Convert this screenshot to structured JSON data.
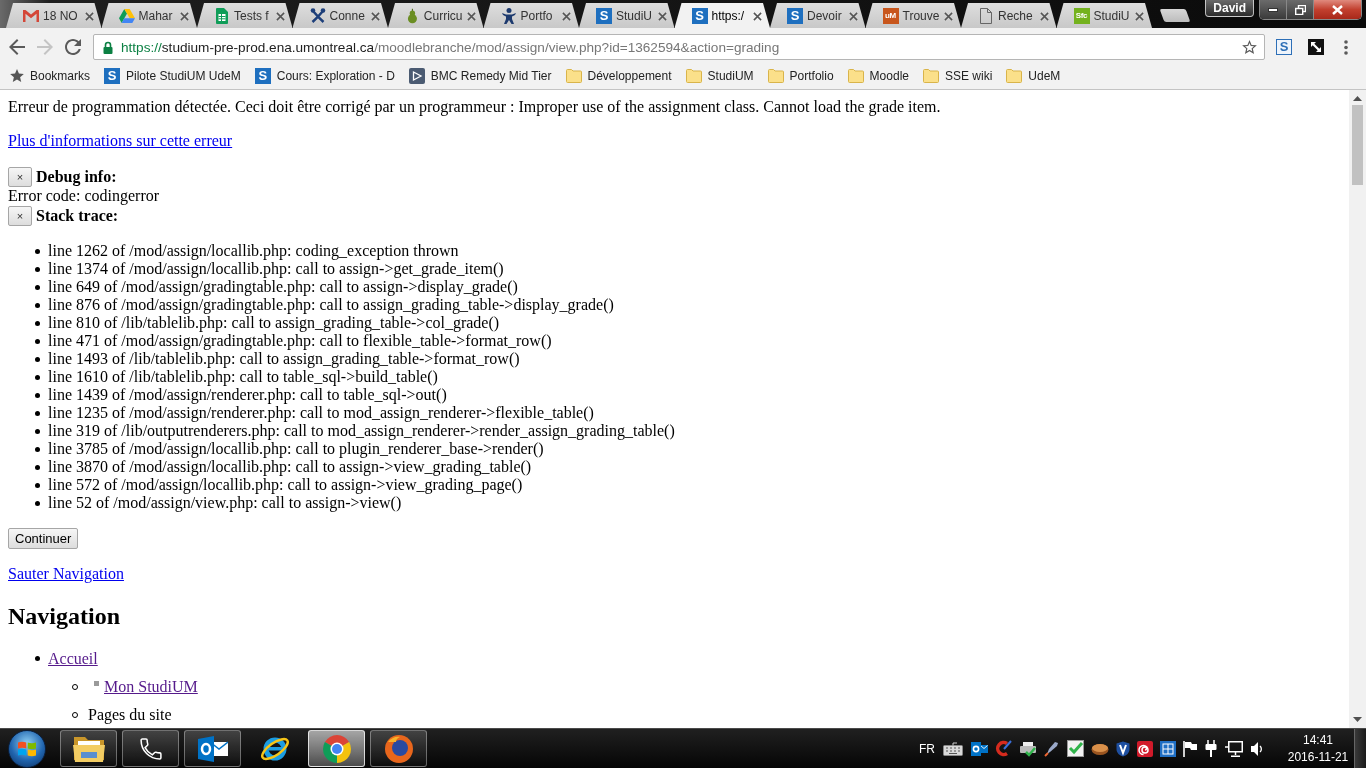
{
  "window": {
    "user": "David"
  },
  "tabs": [
    {
      "title": "18 NO",
      "kind": "mail",
      "selected": false
    },
    {
      "title": "Mahar",
      "kind": "drive",
      "selected": false
    },
    {
      "title": "Tests f",
      "kind": "sheet",
      "selected": false
    },
    {
      "title": "Conne",
      "kind": "tools",
      "selected": false
    },
    {
      "title": "Curricu",
      "kind": "gourd",
      "selected": false
    },
    {
      "title": "Portfo",
      "kind": "people",
      "selected": false
    },
    {
      "title": "StudiU",
      "kind": "letter",
      "logo_text": "S",
      "color": "#1e6fbf",
      "selected": false
    },
    {
      "title": "https:/",
      "kind": "letter",
      "logo_text": "S",
      "color": "#1e6fbf",
      "selected": true
    },
    {
      "title": "Devoir",
      "kind": "letter",
      "logo_text": "S",
      "color": "#1e6fbf",
      "selected": false
    },
    {
      "title": "Trouve",
      "kind": "letter",
      "logo_text": "uM",
      "color": "#c8561c",
      "selected": false
    },
    {
      "title": "Reche",
      "kind": "page",
      "selected": false
    },
    {
      "title": "StudiU",
      "kind": "letter",
      "logo_text": "Sfc",
      "color": "#74b21e",
      "selected": false
    }
  ],
  "toolbar": {
    "back_disabled": false,
    "forward_disabled": true,
    "address": {
      "scheme": "https://",
      "host": "studium-pre-prod.ena.umontreal.ca",
      "path": "/moodlebranche/mod/assign/view.php?id=1362594&action=grading"
    },
    "bookmarked": false,
    "extension_logo_text": "S"
  },
  "bookmarks": [
    {
      "label": "Bookmarks",
      "kind": "star"
    },
    {
      "label": "Pilote StudiUM UdeM",
      "kind": "letter",
      "logo_text": "S"
    },
    {
      "label": "Cours: Exploration - D",
      "kind": "letter",
      "logo_text": "S"
    },
    {
      "label": "BMC Remedy Mid Tier",
      "kind": "app"
    },
    {
      "label": "Développement",
      "kind": "folder"
    },
    {
      "label": "StudiUM",
      "kind": "folder"
    },
    {
      "label": "Portfolio",
      "kind": "folder"
    },
    {
      "label": "Moodle",
      "kind": "folder"
    },
    {
      "label": "SSE wiki",
      "kind": "folder"
    },
    {
      "label": "UdeM",
      "kind": "folder"
    }
  ],
  "page": {
    "error_message": "Erreur de programmation détectée. Ceci doit être corrigé par un programmeur : Improper use of the assignment class. Cannot load the grade item.",
    "more_info_link": {
      "label": "Plus d'informations sur cette erreur",
      "visited": false
    },
    "debug": {
      "toggle": "×",
      "title": "Debug info:",
      "text": "Error code: codingerror"
    },
    "stack": {
      "toggle": "×",
      "title": "Stack trace:",
      "lines": [
        "line 1262 of /mod/assign/locallib.php: coding_exception thrown",
        "line 1374 of /mod/assign/locallib.php: call to assign->get_grade_item()",
        "line 649 of /mod/assign/gradingtable.php: call to assign->display_grade()",
        "line 876 of /mod/assign/gradingtable.php: call to assign_grading_table->display_grade()",
        "line 810 of /lib/tablelib.php: call to assign_grading_table->col_grade()",
        "line 471 of /mod/assign/gradingtable.php: call to flexible_table->format_row()",
        "line 1493 of /lib/tablelib.php: call to assign_grading_table->format_row()",
        "line 1610 of /lib/tablelib.php: call to table_sql->build_table()",
        "line 1439 of /mod/assign/renderer.php: call to table_sql->out()",
        "line 1235 of /mod/assign/renderer.php: call to mod_assign_renderer->flexible_table()",
        "line 319 of /lib/outputrenderers.php: call to mod_assign_renderer->render_assign_grading_table()",
        "line 3785 of /mod/assign/locallib.php: call to plugin_renderer_base->render()",
        "line 3870 of /mod/assign/locallib.php: call to assign->view_grading_table()",
        "line 572 of /mod/assign/locallib.php: call to assign->view_grading_page()",
        "line 52 of /mod/assign/view.php: call to assign->view()"
      ]
    },
    "continue_button": "Continuer",
    "skip_link": {
      "label": "Sauter Navigation",
      "visited": false
    },
    "nav_heading": "Navigation",
    "nav": [
      {
        "label": "Accueil",
        "kind": "link",
        "visited": true,
        "children": [
          {
            "label": "Mon StudiUM",
            "kind": "iconlink",
            "visited": true
          },
          {
            "label": "Pages du site",
            "kind": "text"
          }
        ]
      }
    ]
  },
  "taskbar": {
    "apps": [
      {
        "kind": "files",
        "running": true,
        "selected": false
      },
      {
        "kind": "phone",
        "running": true,
        "selected": false
      },
      {
        "kind": "mail",
        "running": true,
        "selected": false
      },
      {
        "kind": "ie",
        "running": false,
        "selected": false
      },
      {
        "kind": "chrome",
        "running": true,
        "selected": true
      },
      {
        "kind": "firefox",
        "running": true,
        "selected": false
      }
    ],
    "language": "FR",
    "time": "14:41",
    "date": "2016-11-21"
  }
}
